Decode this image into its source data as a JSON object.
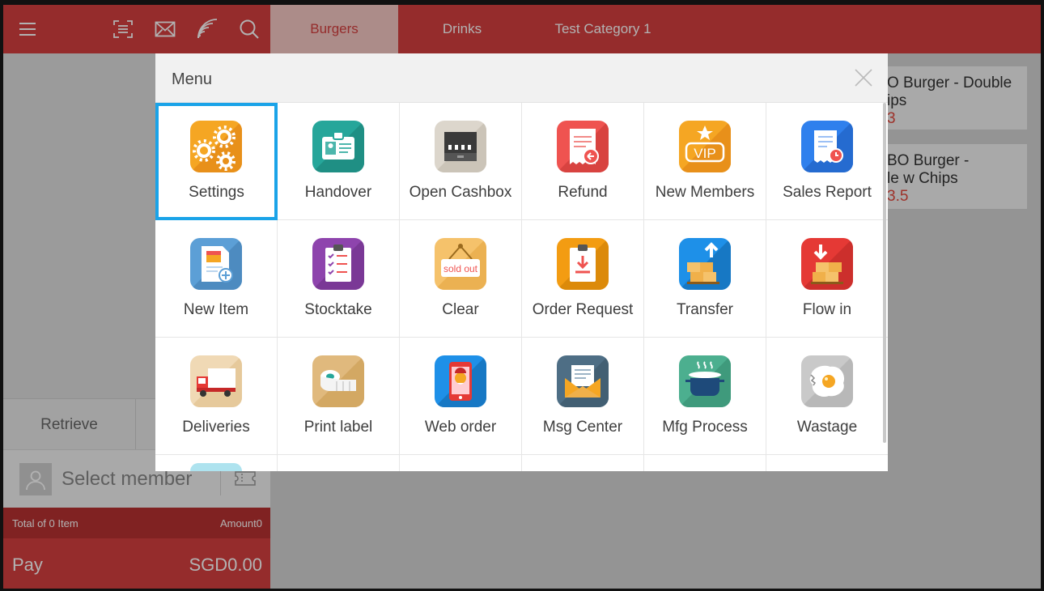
{
  "top_bar": {
    "categories": [
      {
        "label": "Burgers",
        "active": true
      },
      {
        "label": "Drinks",
        "active": false
      },
      {
        "label": "Test Category 1",
        "active": false
      }
    ],
    "tools": [
      "menu-icon",
      "scan-icon",
      "mail-icon",
      "nfc-icon",
      "search-icon"
    ]
  },
  "products": [
    {
      "name": "O Burger - Double",
      "name2": "ips",
      "price": "3"
    },
    {
      "name": "BO Burger -",
      "name2": "le w Chips",
      "price": "3.5"
    }
  ],
  "left_panel": {
    "retrieve_label": "Retrieve",
    "member_placeholder": "Select member",
    "total_label": "Total of 0 Item",
    "amount_label": "Amount0",
    "pay_label": "Pay",
    "pay_amount": "SGD0.00"
  },
  "menu": {
    "title": "Menu",
    "items": [
      {
        "label": "Settings",
        "icon": "settings-icon",
        "selected": true
      },
      {
        "label": "Handover",
        "icon": "handover-icon"
      },
      {
        "label": "Open Cashbox",
        "icon": "cashbox-icon"
      },
      {
        "label": "Refund",
        "icon": "refund-icon"
      },
      {
        "label": "New Members",
        "icon": "vip-icon"
      },
      {
        "label": "Sales Report",
        "icon": "sales-report-icon"
      },
      {
        "label": "New Item",
        "icon": "new-item-icon"
      },
      {
        "label": "Stocktake",
        "icon": "stocktake-icon"
      },
      {
        "label": "Clear",
        "icon": "sold-out-icon",
        "icon_text": "sold out"
      },
      {
        "label": "Order Request",
        "icon": "order-request-icon"
      },
      {
        "label": "Transfer",
        "icon": "transfer-icon"
      },
      {
        "label": "Flow in",
        "icon": "flow-in-icon"
      },
      {
        "label": "Deliveries",
        "icon": "truck-icon"
      },
      {
        "label": "Print label",
        "icon": "label-roll-icon"
      },
      {
        "label": "Web order",
        "icon": "web-order-icon"
      },
      {
        "label": "Msg Center",
        "icon": "envelope-icon"
      },
      {
        "label": "Mfg Process",
        "icon": "pot-icon"
      },
      {
        "label": "Wastage",
        "icon": "wastage-icon"
      }
    ]
  },
  "colors": {
    "brand_red": "#d63f3f",
    "selection_blue": "#1aa3e8"
  }
}
